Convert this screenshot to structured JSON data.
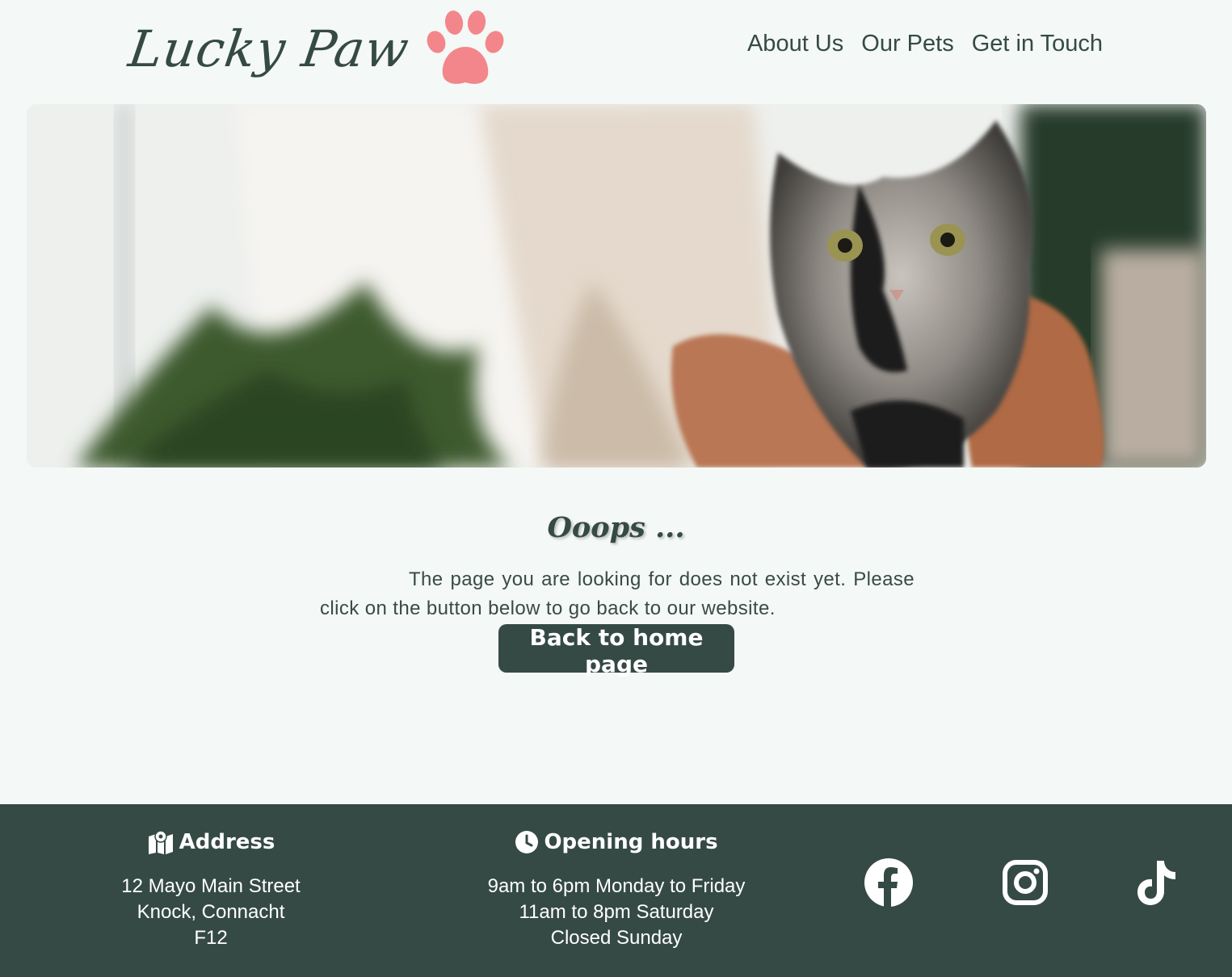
{
  "brand": {
    "name": "Lucky Paw",
    "icon": "paw-icon",
    "accent": "#f3868a"
  },
  "nav": {
    "items": [
      {
        "label": "About Us"
      },
      {
        "label": "Our Pets"
      },
      {
        "label": "Get in Touch"
      }
    ]
  },
  "hero": {
    "image": "cat held in person's arms"
  },
  "main": {
    "title": "Ooops ...",
    "message": "The page you are looking for does not exist yet. Please click on the button below to go back to our website.",
    "button_label": "Back to home page"
  },
  "footer": {
    "address": {
      "icon": "map-location-icon",
      "heading": "Address",
      "lines": [
        "12 Mayo Main Street",
        "Knock, Connacht",
        "F12"
      ]
    },
    "hours": {
      "icon": "clock-icon",
      "heading": "Opening hours",
      "lines": [
        "9am to 6pm Monday to Friday",
        "11am to 8pm Saturday",
        "Closed Sunday"
      ]
    },
    "social": [
      {
        "name": "Facebook",
        "icon": "facebook-icon"
      },
      {
        "name": "Instagram",
        "icon": "instagram-icon"
      },
      {
        "name": "TikTok",
        "icon": "tiktok-icon"
      }
    ]
  },
  "colors": {
    "primary": "#354a44",
    "background": "#f4f8f6",
    "accent": "#f3868a"
  }
}
